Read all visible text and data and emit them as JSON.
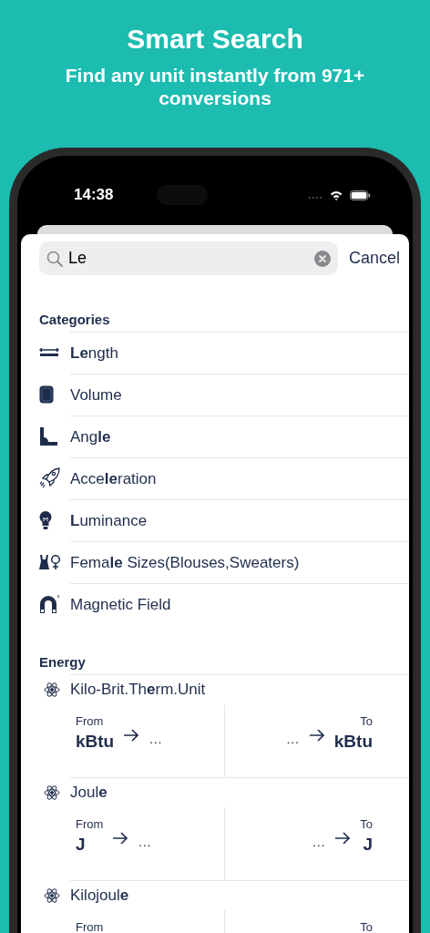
{
  "header": {
    "title": "Smart Search",
    "subtitle": "Find any unit instantly from 971+ conversions"
  },
  "status_bar": {
    "time": "14:38"
  },
  "search": {
    "value": "Le",
    "cancel": "Cancel"
  },
  "categories": {
    "title": "Categories",
    "items": [
      {
        "name": "**Le**ngth"
      },
      {
        "name": "Volume"
      },
      {
        "name": "Ang**le**"
      },
      {
        "name": "Acce**le**ration"
      },
      {
        "name": "**L**uminance"
      },
      {
        "name": "Fema**le** Sizes(Blouses,Sweaters)"
      },
      {
        "name": "Magnetic Field"
      }
    ]
  },
  "energy": {
    "title": "Energy",
    "units": [
      {
        "name": "Kilo-Brit.Th**e**rm.Unit",
        "from_label": "From",
        "from_unit": "kBtu",
        "from_target": "…",
        "to_label": "To",
        "to_source": "…",
        "to_unit": "kBtu"
      },
      {
        "name": "Joul**e**",
        "from_label": "From",
        "from_unit": "J",
        "from_target": "…",
        "to_label": "To",
        "to_source": "…",
        "to_unit": "J"
      },
      {
        "name": "Kilojoul**e**",
        "from_label": "From",
        "to_label": "To"
      }
    ]
  }
}
